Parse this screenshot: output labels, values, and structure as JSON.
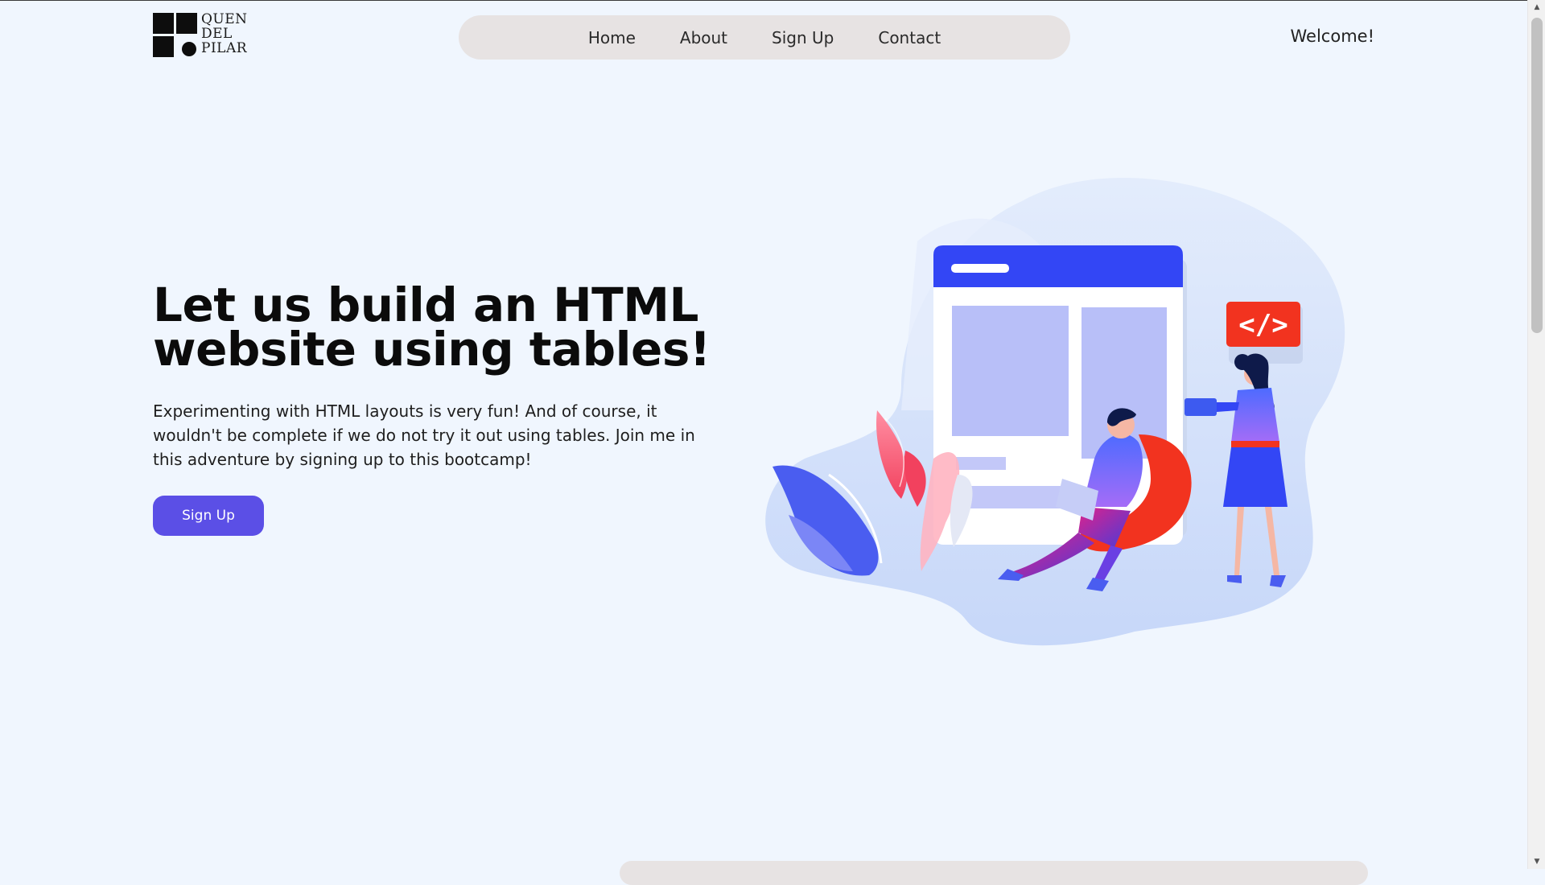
{
  "brand": {
    "logo_lines": [
      "QUEN",
      "DEL",
      "PILAR"
    ]
  },
  "nav": {
    "items": [
      "Home",
      "About",
      "Sign Up",
      "Contact"
    ],
    "greeting": "Welcome!"
  },
  "hero": {
    "title": "Let us build an HTML website using tables!",
    "body": "Experimenting with HTML layouts is very fun! And of course, it wouldn't be complete if we do not try it out using tables. Join me in this adventure by signing up to this bootcamp!",
    "cta_label": "Sign Up"
  },
  "illustration": {
    "code_badge": "</>",
    "icon_names": [
      "browser-window-icon",
      "code-tag-icon",
      "people-illustration",
      "plant-illustration"
    ]
  },
  "colors": {
    "background": "#f0f6fe",
    "accent": "#5b4fe6",
    "nav_pill": "#e7e3e3",
    "browser_header": "#3346f5",
    "code_badge": "#f2331f"
  }
}
